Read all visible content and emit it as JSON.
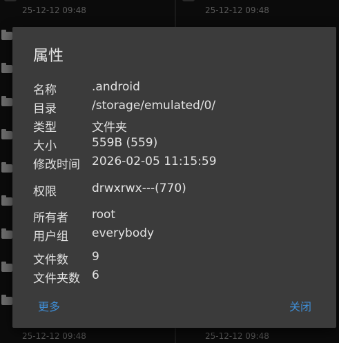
{
  "background": {
    "left_dates": [
      "25-12-12 09:48",
      "25-12-12 09:48"
    ],
    "right_dates": [
      "25-12-12 09:48",
      "25-12-12 09:48"
    ]
  },
  "dialog": {
    "title": "属性",
    "properties": [
      {
        "key": "名称",
        "value": ".android"
      },
      {
        "key": "目录",
        "value": "/storage/emulated/0/"
      },
      {
        "key": "类型",
        "value": "文件夹"
      },
      {
        "key": "大小",
        "value": "559B (559)"
      },
      {
        "key": "修改时间",
        "value": "2026-02-05 11:15:59"
      },
      {
        "key": "权限",
        "value": "drwxrwx---(770)"
      },
      {
        "key": "所有者",
        "value": "root"
      },
      {
        "key": "用户组",
        "value": "everybody"
      },
      {
        "key": "文件数",
        "value": "9"
      },
      {
        "key": "文件夹数",
        "value": "6"
      }
    ],
    "more_label": "更多",
    "close_label": "关闭"
  },
  "colors": {
    "dialog_bg": "#3b3b3b",
    "accent": "#3f8fd8",
    "text": "#e2e2e2",
    "screen_bg": "#0b0b0b"
  }
}
